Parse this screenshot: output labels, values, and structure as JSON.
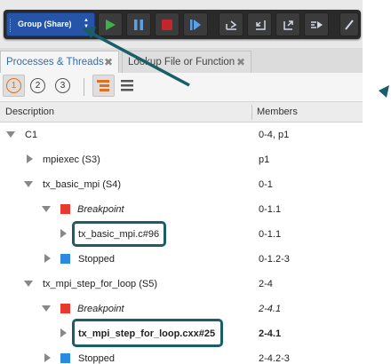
{
  "toolbar": {
    "group_label": "Group (Share)",
    "buttons": [
      "play-icon",
      "pause-icon",
      "stop-icon",
      "step-icon",
      "task-icon-1",
      "task-icon-2",
      "task-icon-3",
      "task-icon-4",
      "edit-icon"
    ]
  },
  "tabs": [
    {
      "label": "Processes & Threads",
      "close": "✖"
    },
    {
      "label": "Lookup File or Function",
      "close": "✖"
    }
  ],
  "subbar": {
    "circles": [
      "1",
      "2",
      "3"
    ]
  },
  "columns": {
    "description": "Description",
    "members": "Members"
  },
  "rows": [
    {
      "label": "C1",
      "members": "0-4, p1"
    },
    {
      "label": "mpiexec (S3)",
      "members": "p1"
    },
    {
      "label": "tx_basic_mpi (S4)",
      "members": "0-1"
    },
    {
      "label": "Breakpoint",
      "members": "0-1.1"
    },
    {
      "label": "tx_basic_mpi.c#96",
      "members": "0-1.1"
    },
    {
      "label": "Stopped",
      "members": "0-1.2-3"
    },
    {
      "label": "tx_mpi_step_for_loop (S5)",
      "members": "2-4"
    },
    {
      "label": "Breakpoint",
      "members": "2-4.1"
    },
    {
      "label": "tx_mpi_step_for_loop.cxx#25",
      "members": "2-4.1"
    },
    {
      "label": "Stopped",
      "members": "2-4.2-3"
    }
  ],
  "colors": {
    "breakpoint": "#e8392f",
    "stopped": "#2a8ae0",
    "highlight": "#1a5e6a",
    "group_button": "#2554a8"
  }
}
